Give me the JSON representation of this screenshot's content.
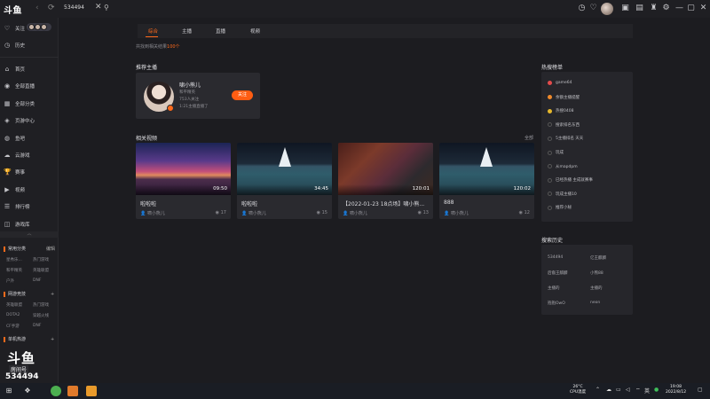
{
  "titlebar": {
    "logo": "斗鱼",
    "search_value": "534494",
    "icons": [
      "history-icon",
      "heart-icon",
      "avatar",
      "calendar-icon",
      "message-icon",
      "skin-icon",
      "settings-icon",
      "minimize-icon",
      "maximize-icon",
      "close-icon"
    ]
  },
  "sidebar": {
    "follow_label": "关注",
    "history_label": "历史",
    "nav": [
      {
        "label": "首页",
        "icon": "home-icon"
      },
      {
        "label": "全部直播",
        "icon": "live-icon"
      },
      {
        "label": "全部分类",
        "icon": "category-icon"
      },
      {
        "label": "页游中心",
        "icon": "game-center-icon"
      },
      {
        "label": "鱼吧",
        "icon": "fishbar-icon"
      },
      {
        "label": "云游戏",
        "icon": "cloud-game-icon"
      },
      {
        "label": "赛事",
        "icon": "trophy-icon"
      },
      {
        "label": "视频",
        "icon": "video-icon"
      },
      {
        "label": "排行榜",
        "icon": "ranking-icon"
      },
      {
        "label": "游戏库",
        "icon": "game-library-icon"
      }
    ],
    "common_title": "常用分类",
    "common_edit": "编辑",
    "common_items": [
      "星秀乐...",
      "热门游戏",
      "和平精英",
      "英雄联盟",
      "户外",
      "DNF"
    ],
    "online_title": "网游竞技",
    "online_items": [
      "英雄联盟",
      "热门游戏",
      "DOTA2",
      "穿越火线",
      "CF手游",
      "DNF"
    ],
    "single_title": "单机热游",
    "brand_big": "斗鱼",
    "brand_room": "房间号",
    "brand_num": "534494"
  },
  "tabs": [
    {
      "label": "综合",
      "active": true
    },
    {
      "label": "主播",
      "active": false
    },
    {
      "label": "直播",
      "active": false
    },
    {
      "label": "视频",
      "active": false
    }
  ],
  "result": {
    "prefix": "共找到相关结果",
    "count": "100个"
  },
  "anchor_section": {
    "title": "推荐主播",
    "name": "啸小熊儿",
    "category": "和平精英",
    "followers": "753人关注",
    "status": "1:21主播直播了",
    "follow_label": "关注"
  },
  "video_section": {
    "title": "相关视频",
    "all_label": "全部",
    "videos": [
      {
        "title": "啦啦啦",
        "duration": "09:50",
        "author": "啸小熊儿",
        "count": "17"
      },
      {
        "title": "啦啦啦",
        "duration": "34:45",
        "author": "啸小熊儿",
        "count": "15"
      },
      {
        "title": "【2022-01-23 18点场】啸小熊...",
        "duration": "120:01",
        "author": "啸小熊儿",
        "count": "13"
      },
      {
        "title": "888",
        "duration": "120:02",
        "author": "啸小熊儿",
        "count": "12"
      }
    ]
  },
  "hot_section": {
    "title": "热搜榜单",
    "items": [
      "game64",
      "余额主播提醒",
      "热搜0408",
      "搜索排名东西",
      "5主播排名 天天",
      "玩成",
      "从mapdpm",
      "已经热播 主成就赛事",
      "玩成主播10",
      "推荐小秘"
    ],
    "dot_colors": [
      "#e34b4b",
      "#f08a2a",
      "#e6b82c"
    ]
  },
  "history_section": {
    "title": "搜索历史",
    "items": [
      "534494",
      "亿王麒麟",
      "后裔王麒麟",
      "小熊88",
      "主播的",
      "主播的",
      "抱抱OwO",
      "neon"
    ]
  },
  "taskbar": {
    "temp": "26°C",
    "temp_label": "CPU温度",
    "time": "19:08",
    "date": "2022/8/12",
    "lang": "英"
  }
}
